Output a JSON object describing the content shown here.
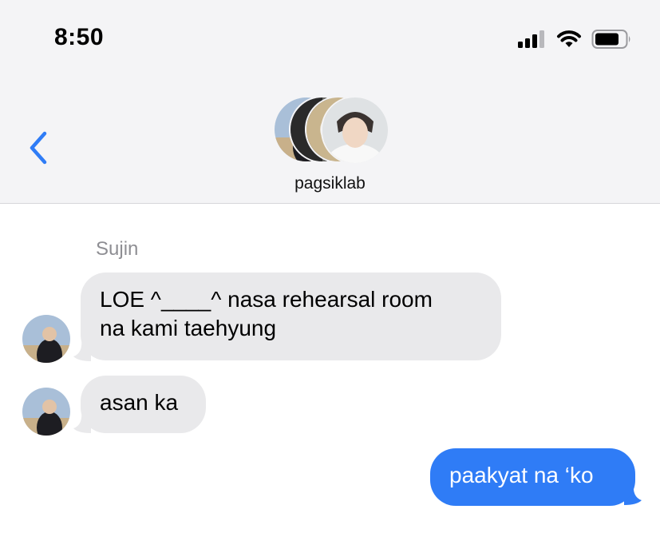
{
  "status_bar": {
    "time": "8:50"
  },
  "conversation": {
    "group_name": "pagsiklab"
  },
  "messages": [
    {
      "sender": "Sujin",
      "text": "LOE ^____^ nasa rehearsal room na kami taehyung",
      "line1": "LOE ^____^ nasa rehearsal room",
      "line2": "na kami taehyung"
    },
    {
      "text": "asan ka"
    },
    {
      "text": "paakyat na ‘ko"
    }
  ],
  "colors": {
    "incoming_bubble": "#e9e9eb",
    "outgoing_bubble": "#2f7cf6",
    "accent": "#2f7cf6"
  }
}
